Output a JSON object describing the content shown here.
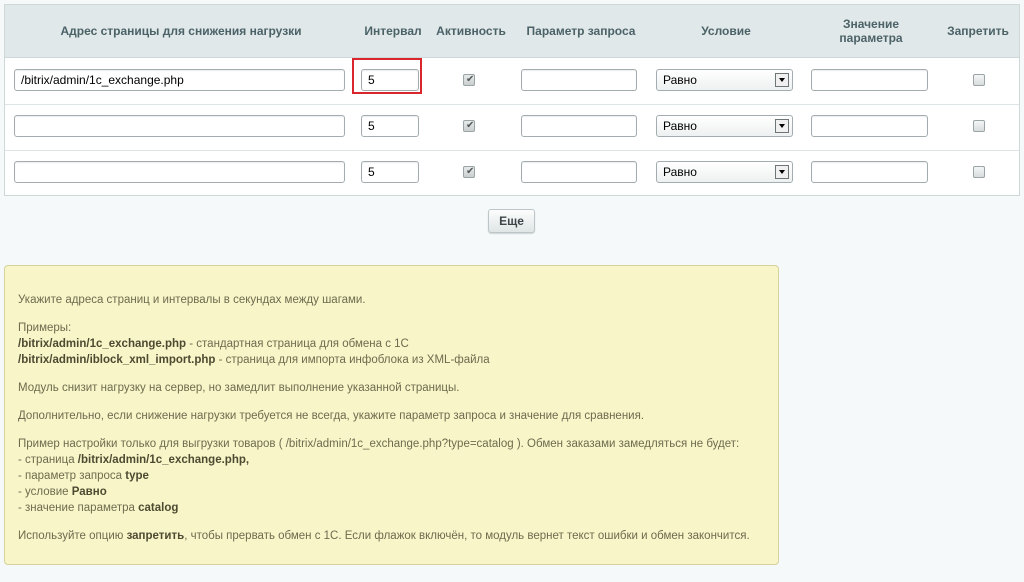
{
  "table": {
    "headers": {
      "address": "Адрес страницы для снижения нагрузки",
      "interval": "Интервал",
      "activity": "Активность",
      "param": "Параметр запроса",
      "condition": "Условие",
      "value_line1": "Значение",
      "value_line2": "параметра",
      "forbid": "Запретить"
    },
    "rows": [
      {
        "address": "/bitrix/admin/1c_exchange.php",
        "interval": "5",
        "active": true,
        "param": "",
        "condition": "Равно",
        "value": "",
        "forbid": false
      },
      {
        "address": "",
        "interval": "5",
        "active": true,
        "param": "",
        "condition": "Равно",
        "value": "",
        "forbid": false
      },
      {
        "address": "",
        "interval": "5",
        "active": true,
        "param": "",
        "condition": "Равно",
        "value": "",
        "forbid": false
      }
    ]
  },
  "more_button": "Еще",
  "note": {
    "intro": "Укажите адреса страниц и интервалы в секундах между шагами.",
    "examples_title": "Примеры:",
    "ex1_path": "/bitrix/admin/1c_exchange.php",
    "ex1_text": " - стандартная страница для обмена с 1С",
    "ex2_path": "/bitrix/admin/iblock_xml_import.php",
    "ex2_text": " - страница для импорта инфоблока из XML-файла",
    "p_module": "Модуль снизит нагрузку на сервер, но замедлит выполнение указанной страницы.",
    "p_extra": "Дополнительно, если снижение нагрузки требуется не всегда, укажите параметр запроса и значение для сравнения.",
    "p_example": "Пример настройки только для выгрузки товаров ( /bitrix/admin/1c_exchange.php?type=catalog ). Обмен заказами замедляться не будет:",
    "li1_pre": "- страница ",
    "li1_bold": "/bitrix/admin/1c_exchange.php,",
    "li2_pre": "- параметр запроса ",
    "li2_bold": "type",
    "li3_pre": "- условие ",
    "li3_bold": "Равно",
    "li4_pre": "- значение параметра ",
    "li4_bold": "catalog",
    "p_forbid_pre": "Используйте опцию ",
    "p_forbid_bold": "запретить",
    "p_forbid_post": ", чтобы прервать обмен с 1С. Если флажок включён, то модуль вернет текст ошибки и обмен закончится."
  },
  "colors": {
    "header_bg": "#e0e8ea",
    "note_bg": "#f8f5c8",
    "highlight": "#d9262c"
  }
}
